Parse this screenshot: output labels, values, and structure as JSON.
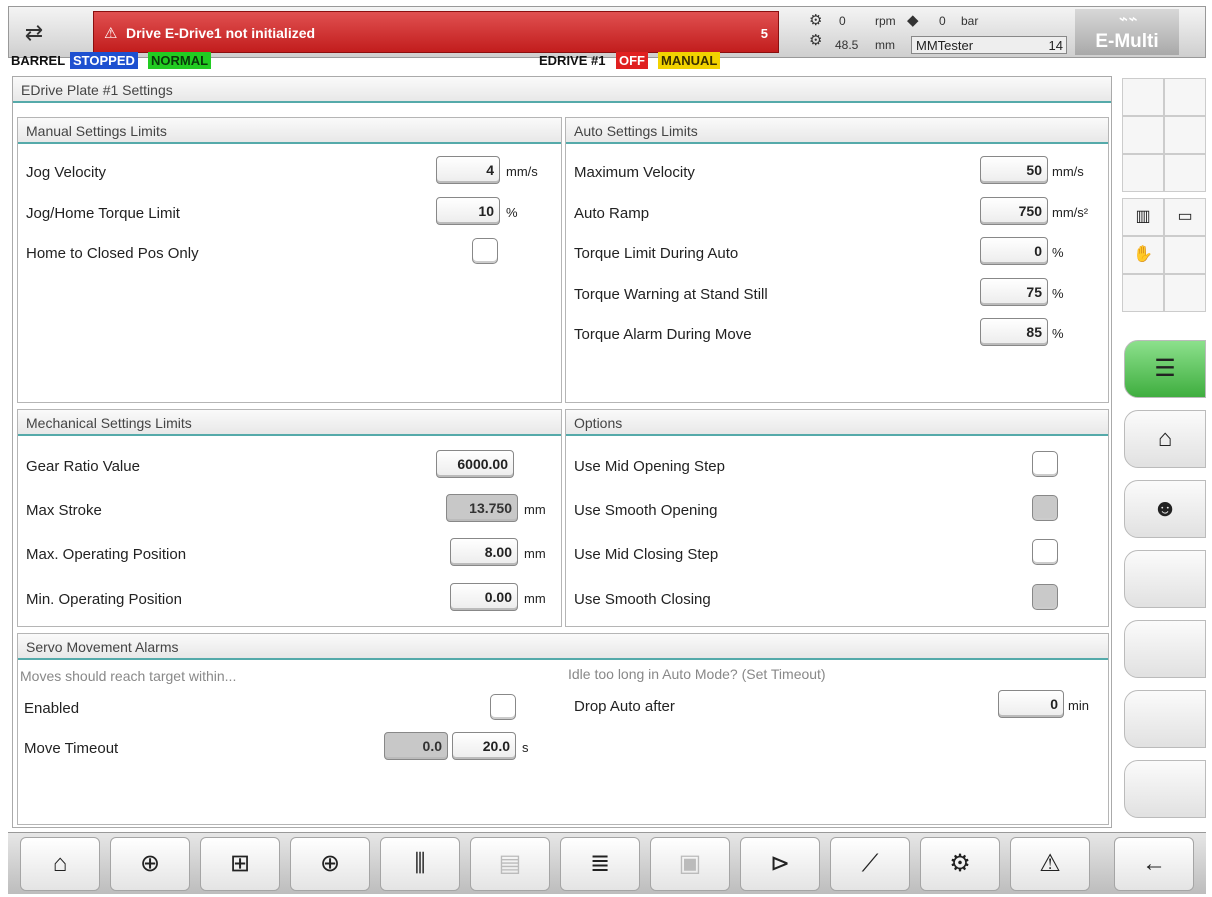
{
  "topbar": {
    "user_switch_icon": "user-switch-icon",
    "alarm": {
      "icon": "warning-triangle-icon",
      "message": "Drive E-Drive1 not initialized",
      "count": "5",
      "color": "#c21d1d"
    },
    "status": {
      "screw_speed_value": "0",
      "screw_speed_unit": "rpm",
      "pressure_value": "0",
      "pressure_unit": "bar",
      "position_value": "48.5",
      "position_unit": "mm"
    },
    "user": {
      "name": "MMTester",
      "level": "14"
    },
    "logo": "E-Multi"
  },
  "strip": {
    "barrel_label": "BARREL",
    "barrel_state": "STOPPED",
    "barrel_mode": "NORMAL",
    "edrive_label": "EDRIVE #1",
    "edrive_state": "OFF",
    "edrive_mode": "MANUAL",
    "colors": {
      "stopped": "#1e50d0",
      "normal": "#22cc22",
      "off": "#e02020",
      "manual": "#f2d200"
    }
  },
  "page": {
    "title": "EDrive Plate #1 Settings"
  },
  "manual_limits": {
    "title": "Manual Settings Limits",
    "jog_velocity": {
      "label": "Jog Velocity",
      "value": "4",
      "unit": "mm/s"
    },
    "jog_torque": {
      "label": "Jog/Home Torque Limit",
      "value": "10",
      "unit": "%"
    },
    "home_closed": {
      "label": "Home to Closed Pos Only",
      "checked": false
    }
  },
  "auto_limits": {
    "title": "Auto Settings Limits",
    "max_velocity": {
      "label": "Maximum Velocity",
      "value": "50",
      "unit": "mm/s"
    },
    "auto_ramp": {
      "label": "Auto Ramp",
      "value": "750",
      "unit": "mm/s²"
    },
    "torque_auto": {
      "label": "Torque Limit During Auto",
      "value": "0",
      "unit": "%"
    },
    "torque_warning": {
      "label": "Torque Warning at Stand Still",
      "value": "75",
      "unit": "%"
    },
    "torque_alarm": {
      "label": "Torque Alarm During Move",
      "value": "85",
      "unit": "%"
    }
  },
  "mechanical": {
    "title": "Mechanical Settings Limits",
    "gear_ratio": {
      "label": "Gear Ratio Value",
      "value": "6000.00"
    },
    "max_stroke": {
      "label": "Max Stroke",
      "value": "13.750",
      "unit": "mm"
    },
    "max_op": {
      "label": "Max. Operating Position",
      "value": "8.00",
      "unit": "mm"
    },
    "min_op": {
      "label": "Min. Operating Position",
      "value": "0.00",
      "unit": "mm"
    }
  },
  "options": {
    "title": "Options",
    "mid_opening": {
      "label": "Use Mid Opening Step",
      "checked": false
    },
    "smooth_opening": {
      "label": "Use Smooth Opening",
      "disabled": true
    },
    "mid_closing": {
      "label": "Use Mid Closing Step",
      "checked": false
    },
    "smooth_closing": {
      "label": "Use Smooth Closing",
      "disabled": true
    }
  },
  "servo": {
    "title": "Servo Movement Alarms",
    "moves_hint": "Moves should reach target within...",
    "enabled": {
      "label": "Enabled",
      "checked": false
    },
    "move_timeout": {
      "label": "Move Timeout",
      "actual": "0.0",
      "value": "20.0",
      "unit": "s"
    },
    "idle_hint": "Idle too long in Auto Mode? (Set Timeout)",
    "drop_auto": {
      "label": "Drop Auto after",
      "value": "0",
      "unit": "min"
    }
  },
  "sidebar": {
    "icons": [
      "heater-icon",
      "display-icon",
      "hand-manual-icon",
      "settings-list-icon",
      "chart-user-icon",
      "operator-icon"
    ]
  },
  "bottom_nav": [
    "home-icon",
    "mold-icon",
    "clamp-icon",
    "injection-icon",
    "temperature-icon",
    "production-icon",
    "list-icon",
    "robot-icon",
    "ejector-icon",
    "graph-icon",
    "settings-gears-icon",
    "alarm-icon",
    "back-arrow-icon"
  ]
}
